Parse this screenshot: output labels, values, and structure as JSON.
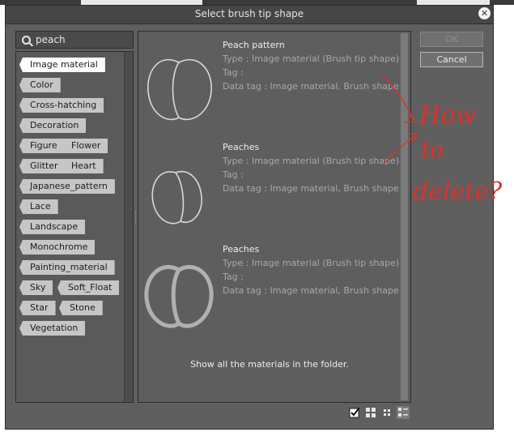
{
  "dialog": {
    "title": "Select brush tip shape"
  },
  "search": {
    "value": "peach"
  },
  "tags": [
    {
      "label": "Image material",
      "selected": true
    },
    {
      "label": "Color"
    },
    {
      "label": "Cross-hatching"
    },
    {
      "label": "Decoration"
    },
    {
      "label": "Figure"
    },
    {
      "label": "Flower"
    },
    {
      "label": "Glitter"
    },
    {
      "label": "Heart"
    },
    {
      "label": "Japanese_pattern"
    },
    {
      "label": "Lace"
    },
    {
      "label": "Landscape"
    },
    {
      "label": "Monochrome"
    },
    {
      "label": "Painting_material"
    },
    {
      "label": "Sky"
    },
    {
      "label": "Soft_Float"
    },
    {
      "label": "Star"
    },
    {
      "label": "Stone"
    },
    {
      "label": "Vegetation"
    }
  ],
  "items": [
    {
      "name": "Peach pattern",
      "type": "Type : Image material (Brush tip shape)",
      "tag": "Tag :",
      "data_tag": "Data tag : Image material, Brush shape"
    },
    {
      "name": "Peaches",
      "type": "Type : Image material (Brush tip shape)",
      "tag": "Tag :",
      "data_tag": "Data tag : Image material, Brush shape"
    },
    {
      "name": "Peaches",
      "type": "Type : Image material (Brush tip shape)",
      "tag": "Tag :",
      "data_tag": "Data tag : Image material, Brush shape"
    }
  ],
  "footer_message": "Show all the materials in the folder.",
  "buttons": {
    "ok": "OK",
    "cancel": "Cancel"
  },
  "view_modes": [
    "checkbox-icon",
    "large-grid-icon",
    "small-grid-icon",
    "list-view-icon"
  ],
  "annotation": {
    "text": [
      "How",
      "to",
      "delete?"
    ],
    "color": "#e0302a"
  },
  "colors": {
    "dialog_bg": "#5f5f5f",
    "tag_bg": "#c6c6c6",
    "tag_selected_bg": "#ffffff"
  }
}
